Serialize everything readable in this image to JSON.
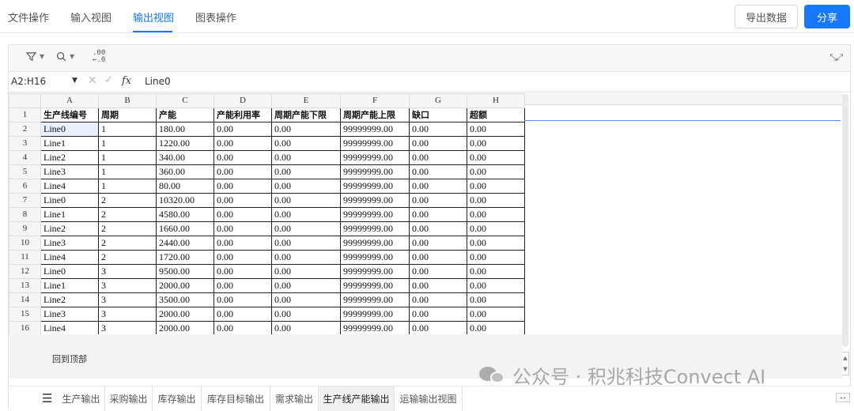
{
  "tabs": [
    {
      "label": "文件操作",
      "active": false
    },
    {
      "label": "输入视图",
      "active": false
    },
    {
      "label": "输出视图",
      "active": true
    },
    {
      "label": "图表操作",
      "active": false
    }
  ],
  "buttons": {
    "export": "导出数据",
    "share": "分享"
  },
  "toolbar": {
    "filter_icon": "filter-icon",
    "search_icon": "zoom-icon",
    "decimal_icon": "decimal-places-icon",
    "decimal_label": ".00"
  },
  "formula_bar": {
    "name_box": "A2:H16",
    "fx": "fx",
    "value": "Line0"
  },
  "sheet": {
    "columns": [
      "A",
      "B",
      "C",
      "D",
      "E",
      "F",
      "G",
      "H"
    ],
    "headers": [
      "生产线编号",
      "周期",
      "产能",
      "产能利用率",
      "周期产能下限",
      "周期产能上限",
      "缺口",
      "超额"
    ],
    "rows": [
      [
        "Line0",
        "1",
        "180.00",
        "0.00",
        "0.00",
        "99999999.00",
        "0.00",
        "0.00"
      ],
      [
        "Line1",
        "1",
        "1220.00",
        "0.00",
        "0.00",
        "99999999.00",
        "0.00",
        "0.00"
      ],
      [
        "Line2",
        "1",
        "340.00",
        "0.00",
        "0.00",
        "99999999.00",
        "0.00",
        "0.00"
      ],
      [
        "Line3",
        "1",
        "360.00",
        "0.00",
        "0.00",
        "99999999.00",
        "0.00",
        "0.00"
      ],
      [
        "Line4",
        "1",
        "80.00",
        "0.00",
        "0.00",
        "99999999.00",
        "0.00",
        "0.00"
      ],
      [
        "Line0",
        "2",
        "10320.00",
        "0.00",
        "0.00",
        "99999999.00",
        "0.00",
        "0.00"
      ],
      [
        "Line1",
        "2",
        "4580.00",
        "0.00",
        "0.00",
        "99999999.00",
        "0.00",
        "0.00"
      ],
      [
        "Line2",
        "2",
        "1660.00",
        "0.00",
        "0.00",
        "99999999.00",
        "0.00",
        "0.00"
      ],
      [
        "Line3",
        "2",
        "2440.00",
        "0.00",
        "0.00",
        "99999999.00",
        "0.00",
        "0.00"
      ],
      [
        "Line4",
        "2",
        "1720.00",
        "0.00",
        "0.00",
        "99999999.00",
        "0.00",
        "0.00"
      ],
      [
        "Line0",
        "3",
        "9500.00",
        "0.00",
        "0.00",
        "99999999.00",
        "0.00",
        "0.00"
      ],
      [
        "Line1",
        "3",
        "2000.00",
        "0.00",
        "0.00",
        "99999999.00",
        "0.00",
        "0.00"
      ],
      [
        "Line2",
        "3",
        "3500.00",
        "0.00",
        "0.00",
        "99999999.00",
        "0.00",
        "0.00"
      ],
      [
        "Line3",
        "3",
        "2000.00",
        "0.00",
        "0.00",
        "99999999.00",
        "0.00",
        "0.00"
      ],
      [
        "Line4",
        "3",
        "2000.00",
        "0.00",
        "0.00",
        "99999999.00",
        "0.00",
        "0.00"
      ]
    ],
    "selected_cell": "A2"
  },
  "back_to_top": "回到顶部",
  "sheet_tabs": [
    {
      "label": "生产输出",
      "active": false
    },
    {
      "label": "采购输出",
      "active": false
    },
    {
      "label": "库存输出",
      "active": false
    },
    {
      "label": "库存目标输出",
      "active": false
    },
    {
      "label": "需求输出",
      "active": false
    },
    {
      "label": "生产线产能输出",
      "active": true
    },
    {
      "label": "运输输出视图",
      "active": false
    }
  ],
  "watermark": "公众号 · 积兆科技Convect AI",
  "colors": {
    "accent": "#1677ff",
    "selection": "#e8f0fd"
  }
}
